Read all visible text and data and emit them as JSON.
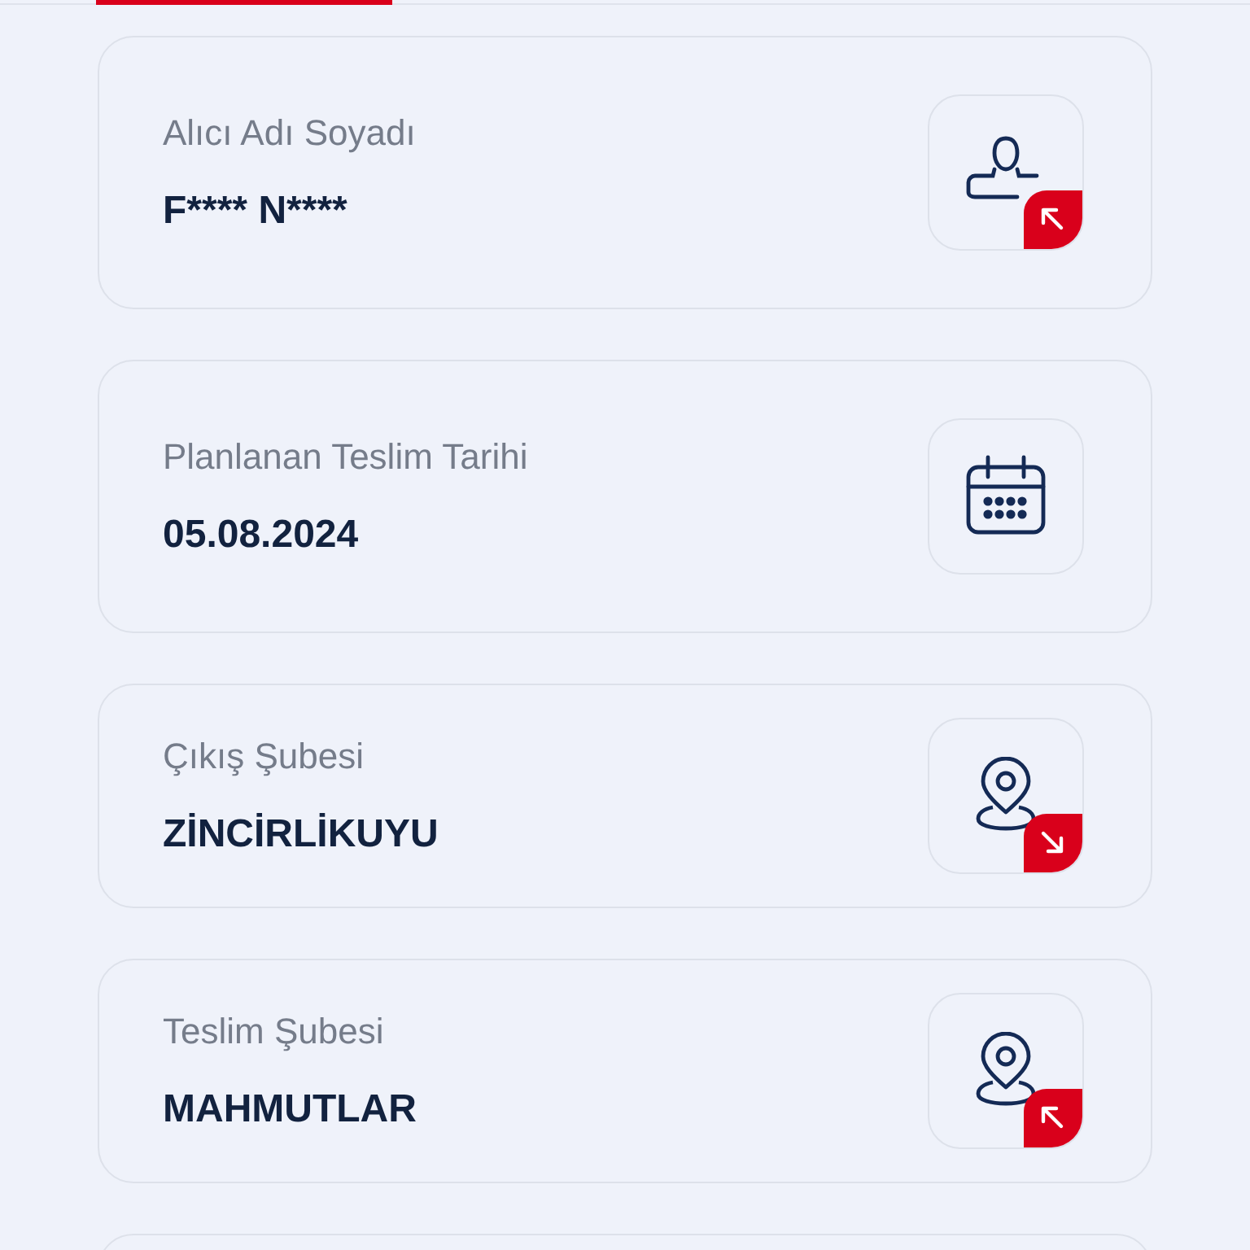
{
  "cards": [
    {
      "label": "Alıcı Adı Soyadı",
      "value": "F**** N****",
      "kind": "recipient"
    },
    {
      "label": "Planlanan Teslim Tarihi",
      "value": "05.08.2024",
      "kind": "date"
    },
    {
      "label": "Çıkış Şubesi",
      "value": "ZİNCİRLİKUYU",
      "kind": "origin"
    },
    {
      "label": "Teslim Şubesi",
      "value": "MAHMUTLAR",
      "kind": "destination"
    }
  ]
}
